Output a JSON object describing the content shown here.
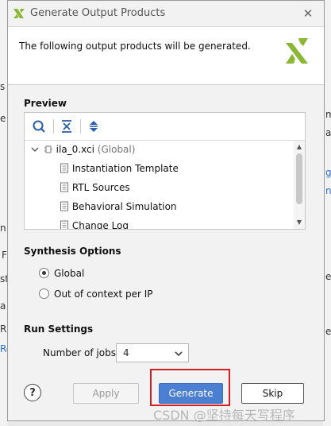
{
  "dialog": {
    "title": "Generate Output Products",
    "close_glyph": "✕",
    "description": "The following output products will be generated."
  },
  "preview": {
    "heading": "Preview",
    "toolbar": [
      "search-icon",
      "collapse-all-icon",
      "expand-all-icon"
    ],
    "tree": {
      "root_name": "ila_0.xci",
      "root_scope": "(Global)",
      "children": [
        "Instantiation Template",
        "RTL Sources",
        "Behavioral Simulation",
        "Change Log"
      ]
    }
  },
  "synthesis": {
    "heading": "Synthesis Options",
    "options": [
      {
        "label": "Global",
        "selected": true
      },
      {
        "label": "Out of context per IP",
        "selected": false
      }
    ]
  },
  "run": {
    "heading": "Run Settings",
    "jobs_label": "Number of jobs:",
    "jobs_value": "4"
  },
  "buttons": {
    "help": "?",
    "apply": "Apply",
    "generate": "Generate",
    "skip": "Skip"
  },
  "watermark": "CSDN @坚持每天写程序",
  "background_fragments": {
    "left": [
      "s",
      "e",
      "n",
      "F",
      "st",
      "a",
      "R",
      "Re"
    ],
    "right": [
      "m",
      "a",
      "g",
      "n",
      "e",
      "e"
    ]
  },
  "colors": {
    "accent": "#4a7fd1",
    "highlight": "#d62020",
    "logo_green": "#8ab836"
  }
}
